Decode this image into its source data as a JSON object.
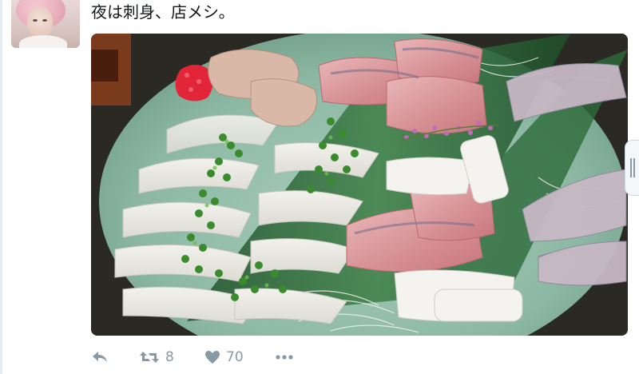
{
  "tweet": {
    "author": {
      "avatar_icon": "user-avatar"
    },
    "text": "夜は刺身、店メシ。",
    "media": {
      "icon": "photo-sashimi-platter"
    },
    "actions": {
      "reply": {
        "icon": "reply-icon"
      },
      "retweet": {
        "icon": "retweet-icon",
        "count": "8"
      },
      "like": {
        "icon": "heart-icon",
        "count": "70"
      },
      "more": {
        "icon": "more-dots-icon"
      }
    }
  },
  "colors": {
    "text": "#14171a",
    "muted": "#8899a6",
    "plate": "#8fb9a6",
    "leaf": "#2e6b3a"
  }
}
